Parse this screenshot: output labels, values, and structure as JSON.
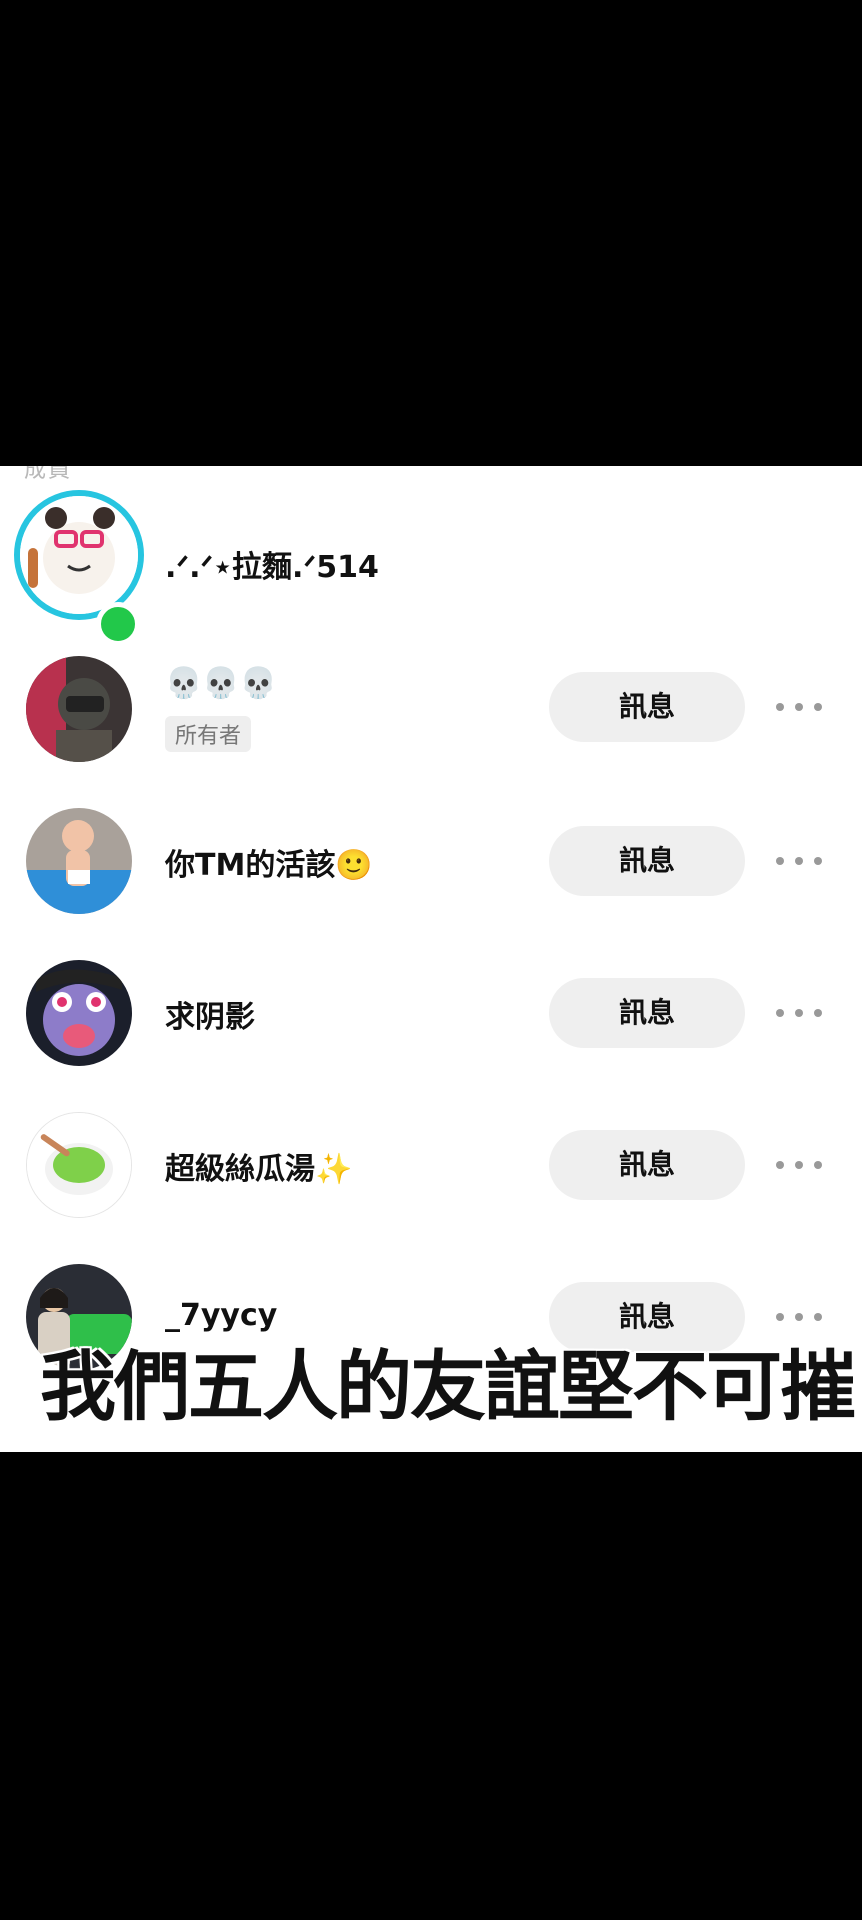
{
  "header_cut": "成員",
  "members": [
    {
      "name": ".ᐟ.ᐟ⋆拉麵.ᐟ514",
      "is_owner": true,
      "online": true
    },
    {
      "name": "💀💀💀",
      "badge": "所有者",
      "button": "訊息"
    },
    {
      "name": "你TM的活該🙂",
      "button": "訊息"
    },
    {
      "name": "求阴影",
      "button": "訊息"
    },
    {
      "name": "超級絲瓜湯✨",
      "button": "訊息"
    },
    {
      "name": "_7yycy",
      "button": "訊息"
    }
  ],
  "caption": "我們五人的友誼堅不可摧",
  "colors": {
    "owner_ring": "#27c5e0",
    "online": "#22c84a",
    "button_bg": "#efefef"
  },
  "icons": [
    "more-options-icon"
  ]
}
